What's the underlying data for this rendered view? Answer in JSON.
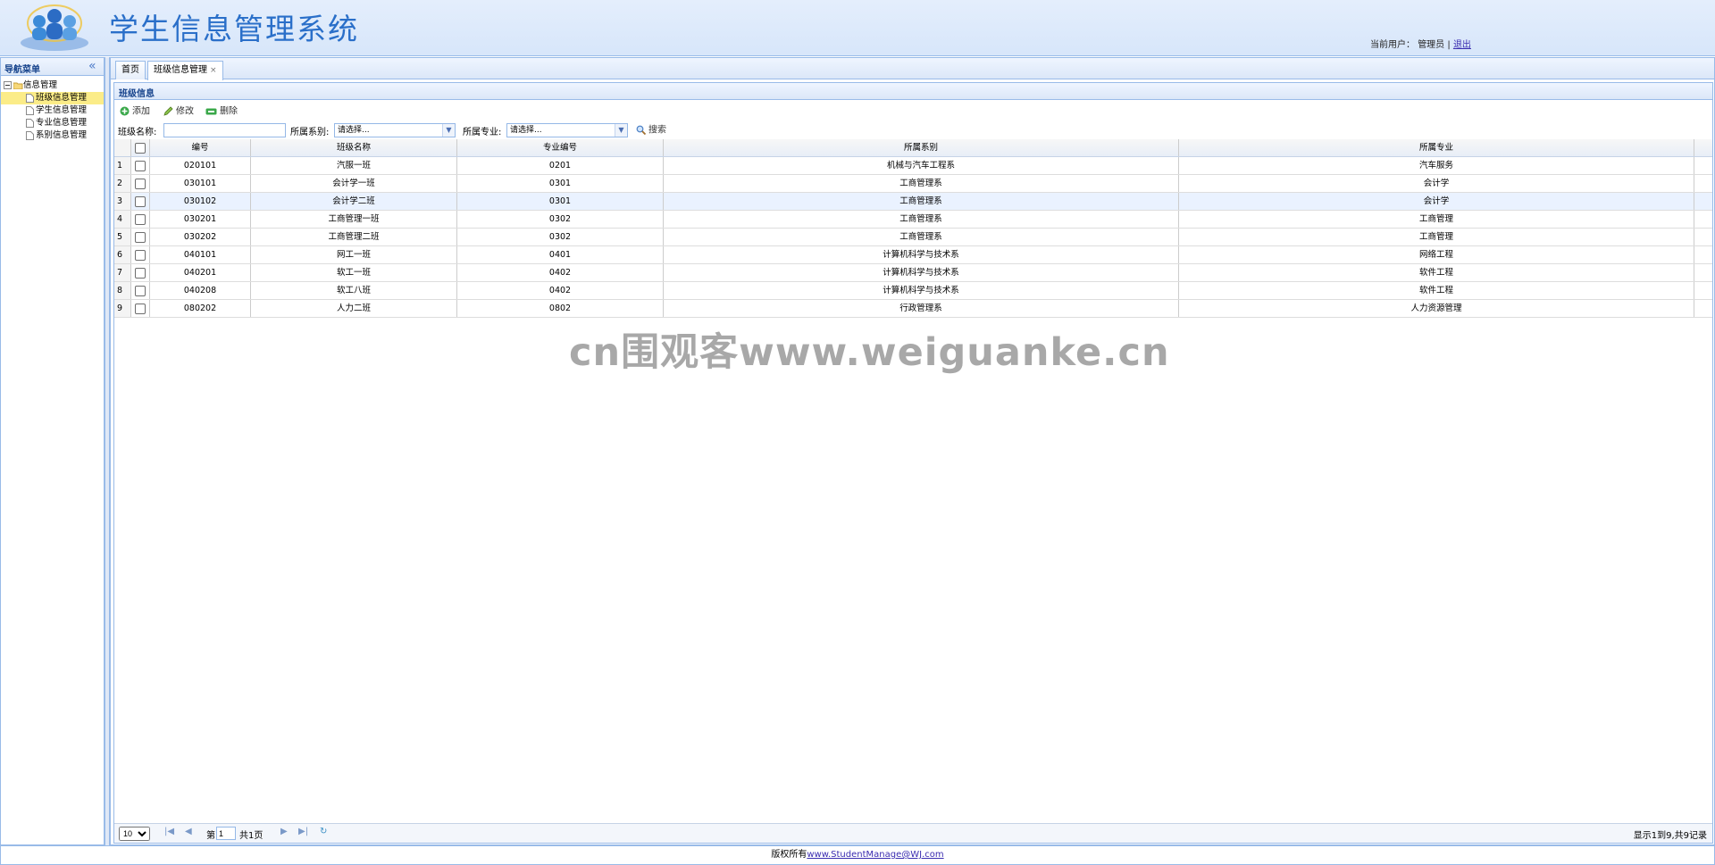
{
  "header": {
    "title": "学生信息管理系统",
    "user_label": "当前用户：",
    "user_name": "管理员",
    "separator": "|",
    "logout": "退出"
  },
  "nav": {
    "title": "导航菜单",
    "root": "信息管理",
    "items": [
      "班级信息管理",
      "学生信息管理",
      "专业信息管理",
      "系别信息管理"
    ]
  },
  "tabs": [
    {
      "label": "首页"
    },
    {
      "label": "班级信息管理",
      "close": "×"
    }
  ],
  "panel": {
    "title": "班级信息",
    "toolbar": {
      "add": "添加",
      "edit": "修改",
      "delete": "删除"
    },
    "search": {
      "class_name_label": "班级名称:",
      "class_name_value": "",
      "dept_label": "所属系别:",
      "dept_value": "请选择...",
      "major_label": "所属专业:",
      "major_value": "请选择...",
      "search_button": "搜索"
    }
  },
  "grid": {
    "columns": [
      "编号",
      "班级名称",
      "专业编号",
      "所属系别",
      "所属专业"
    ],
    "rows": [
      {
        "n": "1",
        "id": "020101",
        "name": "汽服一班",
        "major_id": "0201",
        "dept": "机械与汽车工程系",
        "major": "汽车服务"
      },
      {
        "n": "2",
        "id": "030101",
        "name": "会计学一班",
        "major_id": "0301",
        "dept": "工商管理系",
        "major": "会计学"
      },
      {
        "n": "3",
        "id": "030102",
        "name": "会计学二班",
        "major_id": "0301",
        "dept": "工商管理系",
        "major": "会计学"
      },
      {
        "n": "4",
        "id": "030201",
        "name": "工商管理一班",
        "major_id": "0302",
        "dept": "工商管理系",
        "major": "工商管理"
      },
      {
        "n": "5",
        "id": "030202",
        "name": "工商管理二班",
        "major_id": "0302",
        "dept": "工商管理系",
        "major": "工商管理"
      },
      {
        "n": "6",
        "id": "040101",
        "name": "网工一班",
        "major_id": "0401",
        "dept": "计算机科学与技术系",
        "major": "网络工程"
      },
      {
        "n": "7",
        "id": "040201",
        "name": "软工一班",
        "major_id": "0402",
        "dept": "计算机科学与技术系",
        "major": "软件工程"
      },
      {
        "n": "8",
        "id": "040208",
        "name": "软工八班",
        "major_id": "0402",
        "dept": "计算机科学与技术系",
        "major": "软件工程"
      },
      {
        "n": "9",
        "id": "080202",
        "name": "人力二班",
        "major_id": "0802",
        "dept": "行政管理系",
        "major": "人力资源管理"
      }
    ]
  },
  "watermark": "cn围观客www.weiguanke.cn",
  "pager": {
    "page_size": "10",
    "page_prefix": "第",
    "page_value": "1",
    "page_total": "共1页",
    "summary": "显示1到9,共9记录"
  },
  "footer": {
    "prefix": "版权所有",
    "link": "www.StudentManage@WJ.com"
  }
}
